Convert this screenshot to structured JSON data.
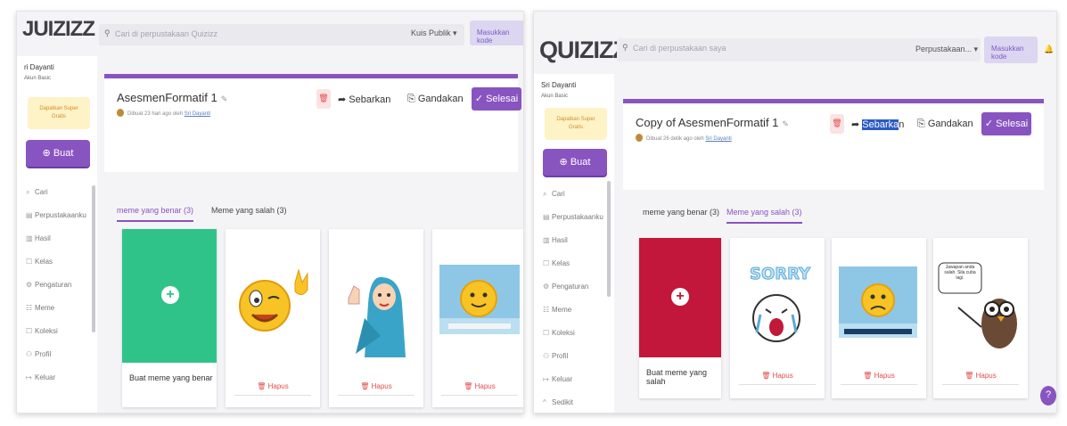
{
  "left": {
    "logo": "JUIZIZZ",
    "search_placeholder": "Cari di perpustakaan Quizizz",
    "scope": "Kuis Publik ▾",
    "join": "Masukkan kode",
    "user_name": "ri Dayanti",
    "user_tag": "Akun Basic",
    "upgrade": "Dapatkan Super Gratis",
    "create": "⊕ Buat",
    "nav": [
      "Cari",
      "Perpustakaanku",
      "Hasil",
      "Kelas",
      "Pengaturan",
      "Meme",
      "Koleksi",
      "Profil",
      "Keluar"
    ],
    "nav_icons": [
      "search-icon",
      "library-icon",
      "chart-icon",
      "class-icon",
      "gear-icon",
      "meme-icon",
      "collection-icon",
      "profile-icon",
      "logout-icon"
    ],
    "quiz_title": "AsesmenFormatif 1",
    "meta_prefix": "Dibuat 23 hari ago oleh",
    "meta_author": "Sri Dayanti",
    "share": "Sebarkan",
    "duplicate": "Gandakan",
    "done": "✓ Selesai",
    "tabs": [
      "meme yang benar (3)",
      "Meme yang salah (3)"
    ],
    "add_label": "Buat meme yang benar",
    "hapus": "Hapus"
  },
  "right": {
    "logo": "QUIZIZZ",
    "search_placeholder": "Cari di perpustakaan saya",
    "scope": "Perpustakaan... ▾",
    "join": "Masukkan kode",
    "user_name": "Sri Dayanti",
    "user_tag": "Akun Basic",
    "upgrade": "Dapatkan Super Gratis",
    "create": "⊕ Buat",
    "nav": [
      "Cari",
      "Perpustakaanku",
      "Hasil",
      "Kelas",
      "Pengaturan",
      "Meme",
      "Koleksi",
      "Profil",
      "Keluar",
      "Sedikit"
    ],
    "nav_icons": [
      "search-icon",
      "library-icon",
      "chart-icon",
      "class-icon",
      "gear-icon",
      "meme-icon",
      "collection-icon",
      "profile-icon",
      "logout-icon",
      "collapse-icon"
    ],
    "quiz_title": "Copy of AsesmenFormatif 1",
    "meta_prefix": "Dibuat 26 detik ago oleh",
    "meta_author": "Sri Dayanti",
    "share_highlight": "Sebarka",
    "share_rest": "n",
    "duplicate": "Gandakan",
    "done": "✓ Selesai",
    "tabs": [
      "meme yang benar (3)",
      "Meme yang salah (3)"
    ],
    "add_label": "Buat meme yang salah",
    "hapus": "Hapus",
    "bubble_text": "Jawapan anda salah. Sila cuba lagi.",
    "help": "?"
  },
  "colors": {
    "brand": "#8854c0",
    "add_correct": "#2fc38a",
    "add_wrong": "#c2173a",
    "delete": "#e14d4d"
  }
}
